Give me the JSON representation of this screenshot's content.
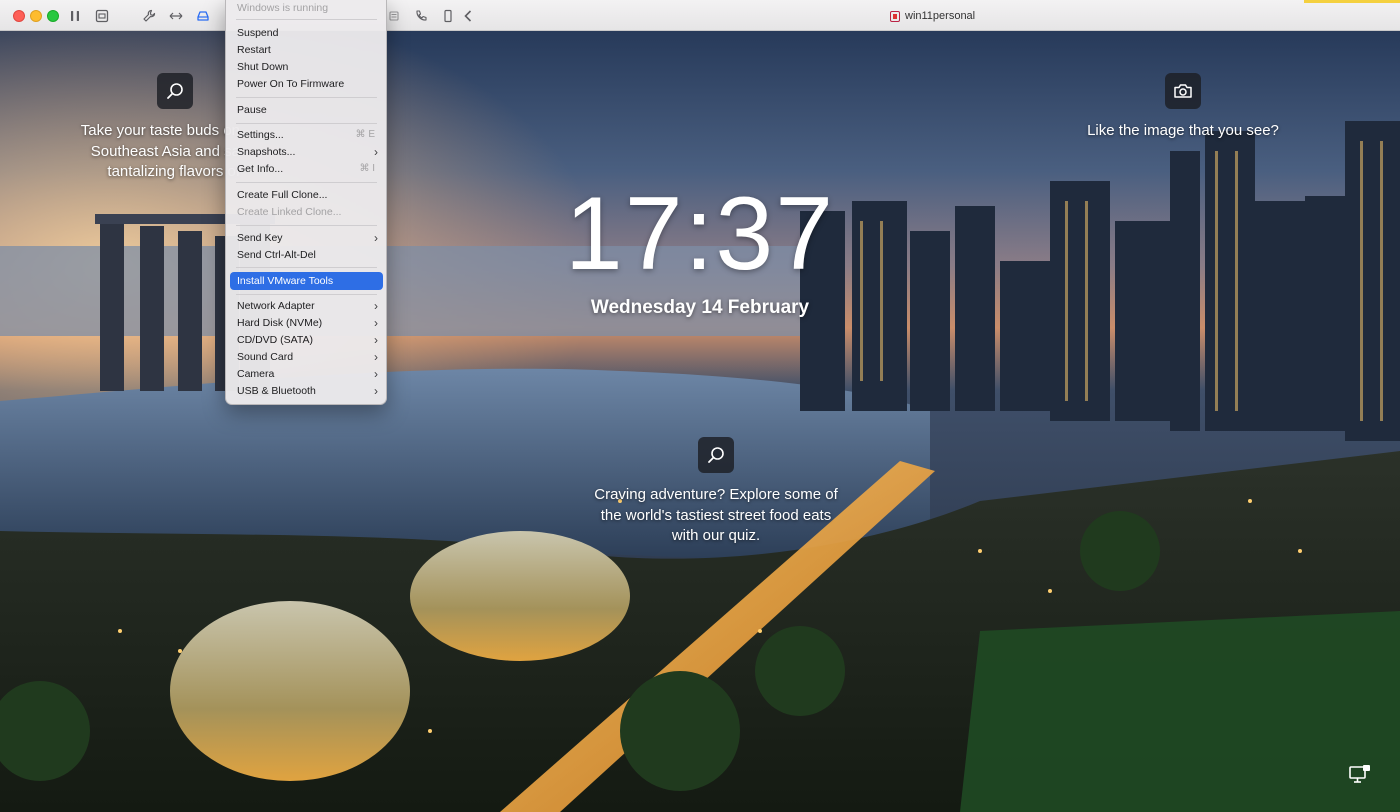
{
  "window": {
    "title": "win11personal"
  },
  "menu": {
    "status": "Windows is running",
    "items": [
      {
        "label": "Suspend"
      },
      {
        "label": "Restart"
      },
      {
        "label": "Shut Down"
      },
      {
        "label": "Power On To Firmware"
      },
      {
        "label": "Pause"
      },
      {
        "label": "Settings...",
        "shortcut": "⌘ E"
      },
      {
        "label": "Snapshots...",
        "submenu": true
      },
      {
        "label": "Get Info...",
        "shortcut": "⌘ I"
      },
      {
        "label": "Create Full Clone..."
      },
      {
        "label": "Create Linked Clone...",
        "disabled": true
      },
      {
        "label": "Send Key",
        "submenu": true
      },
      {
        "label": "Send Ctrl-Alt-Del"
      },
      {
        "label": "Install VMware Tools",
        "highlighted": true
      },
      {
        "label": "Network Adapter",
        "submenu": true
      },
      {
        "label": "Hard Disk (NVMe)",
        "submenu": true
      },
      {
        "label": "CD/DVD (SATA)",
        "submenu": true
      },
      {
        "label": "Sound Card",
        "submenu": true
      },
      {
        "label": "Camera",
        "submenu": true
      },
      {
        "label": "USB & Bluetooth",
        "submenu": true
      }
    ]
  },
  "lockscreen": {
    "time": "17:37",
    "date": "Wednesday 14 February",
    "left_card": {
      "lines": [
        "Take your taste buds on",
        "Southeast Asia and sa",
        "tantalizing flavors of"
      ]
    },
    "right_card": {
      "text": "Like the image that you see?"
    },
    "center_card": {
      "lines": [
        "Craving adventure? Explore some of",
        "the world's tastiest street food eats",
        "with our quiz."
      ]
    }
  },
  "colors": {
    "menu_highlight": "#2e6ee5",
    "close": "#fe5f57",
    "minimize": "#febc2e",
    "maximize": "#28c840"
  },
  "icons": [
    "pause-icon",
    "vm-library-icon",
    "wrench-icon",
    "resize-icon",
    "disk-drive-icon",
    "usb-icon",
    "phone-icon",
    "device-icon",
    "back-chevron-icon",
    "search-icon",
    "camera-icon",
    "network-icon"
  ]
}
